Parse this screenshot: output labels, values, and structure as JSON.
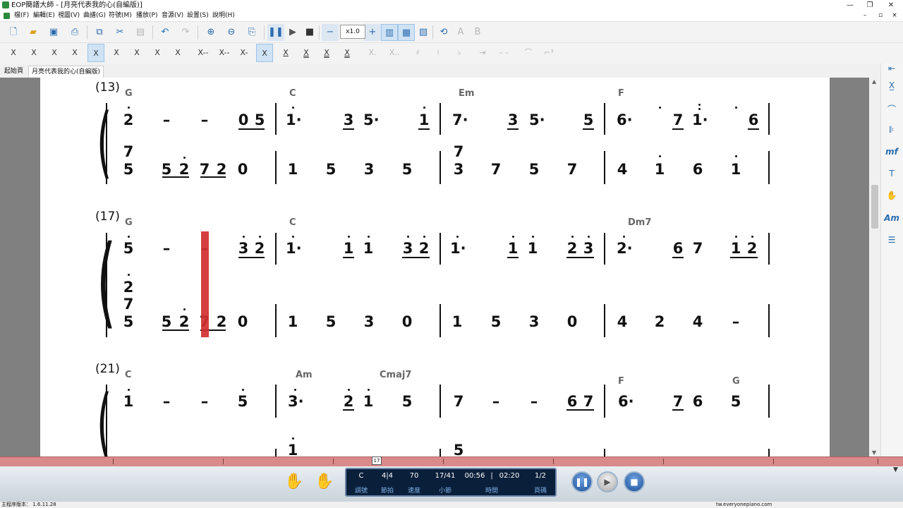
{
  "window": {
    "title": "EOP簡譜大師 - [月亮代表我的心(自編版)]"
  },
  "menu": [
    "檔(F)",
    "編輯(E)",
    "視圖(V)",
    "曲譜(G)",
    "符號(M)",
    "播放(P)",
    "音源(V)",
    "設置(S)",
    "說明(H)"
  ],
  "toolbar": {
    "zoom": "x1.0"
  },
  "tabs": [
    "起始頁",
    "月亮代表我的心(自編版)"
  ],
  "symbols": [
    "X",
    "X",
    "X",
    "X",
    "X",
    "X",
    "X",
    "X",
    "X",
    "X--",
    "X--",
    "X-",
    "X",
    "X",
    "X",
    "X",
    "X",
    "X.",
    "X..",
    "♯",
    "♮",
    "♭"
  ],
  "score": {
    "measures": [
      "(13)",
      "(17)",
      "(21)"
    ],
    "row1": {
      "chords": [
        "G",
        "C",
        "Em",
        "F"
      ],
      "melody": [
        "2",
        "–",
        "–",
        "0",
        "5",
        "1·",
        "3",
        "5·",
        "1",
        "7·",
        "3",
        "5·",
        "5",
        "6·",
        "7",
        "1·",
        "6"
      ],
      "bass_upper": [
        "7",
        "5"
      ],
      "bass": [
        "5",
        "5",
        "2",
        "7",
        "2",
        "0",
        "1",
        "5",
        "3",
        "5",
        "3",
        "7",
        "5",
        "7",
        "4",
        "1",
        "6",
        "1"
      ]
    },
    "row2": {
      "chords": [
        "G",
        "C",
        "Dm7"
      ],
      "melody": [
        "5",
        "–",
        "–",
        "3",
        "2",
        "1·",
        "1",
        "1",
        "3",
        "2",
        "1·",
        "1",
        "1",
        "2",
        "3",
        "2·",
        "6",
        "7",
        "1",
        "2"
      ],
      "bass_upper": [
        "2",
        "7"
      ],
      "bass": [
        "5",
        "5",
        "2",
        "7",
        "2",
        "0",
        "1",
        "5",
        "3",
        "0",
        "1",
        "5",
        "3",
        "0",
        "4",
        "2",
        "4",
        "–"
      ]
    },
    "row3": {
      "chords": [
        "C",
        "Am",
        "Cmaj7",
        "F",
        "G"
      ],
      "melody": [
        "1",
        "–",
        "–",
        "5",
        "3·",
        "2",
        "1",
        "5",
        "7",
        "–",
        "–",
        "6",
        "7",
        "6·",
        "7",
        "6",
        "5"
      ],
      "bass": [
        "1",
        "5"
      ]
    }
  },
  "timeline": {
    "marker": "17"
  },
  "player": {
    "key": "C",
    "time_sig": "4|4",
    "tempo": "70",
    "measure": "17/41",
    "elapsed": "00:56",
    "total": "02:20",
    "page": "1/2",
    "labels": {
      "key": "調號",
      "beat": "節拍",
      "tempo": "速度",
      "measure": "小節",
      "time": "時間",
      "page": "頁碼"
    }
  },
  "status": {
    "version": "主程序版本： 1.6.11.28",
    "site": "tw.everyonepiano.com"
  }
}
